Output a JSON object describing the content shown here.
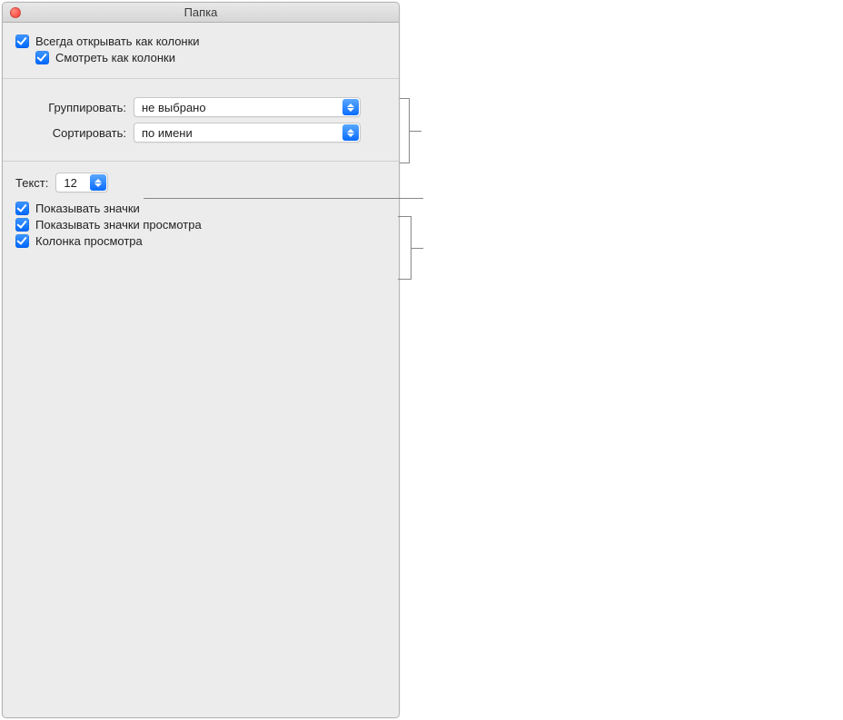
{
  "window": {
    "title": "Папка"
  },
  "top": {
    "always_open_label": "Всегда открывать как колонки",
    "browse_label": "Смотреть как колонки"
  },
  "mid": {
    "group_label": "Группировать:",
    "group_value": "не выбрано",
    "sort_label": "Сортировать:",
    "sort_value": "по имени"
  },
  "low": {
    "text_label": "Текст:",
    "text_value": "12",
    "show_icons_label": "Показывать значки",
    "show_icon_preview_label": "Показывать значки просмотра",
    "preview_column_label": "Колонка просмотра"
  }
}
